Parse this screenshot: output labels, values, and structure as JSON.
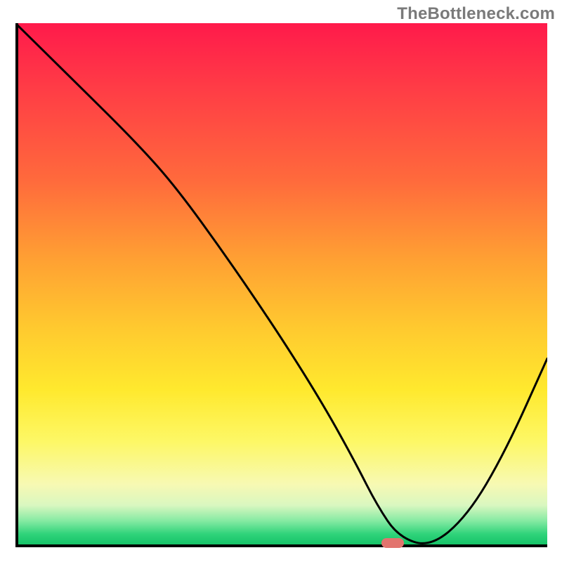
{
  "watermark": "TheBottleneck.com",
  "chart_data": {
    "type": "line",
    "title": "",
    "xlabel": "",
    "ylabel": "",
    "xlim": [
      0,
      100
    ],
    "ylim": [
      0,
      100
    ],
    "x": [
      0,
      10,
      22,
      30,
      40,
      50,
      58,
      64,
      68,
      72,
      78,
      85,
      92,
      100
    ],
    "values": [
      100,
      90,
      78,
      69,
      55,
      40,
      27,
      16,
      8,
      2,
      0,
      6,
      18,
      36
    ],
    "marker": {
      "x": 71,
      "y": 0.5
    },
    "background_gradient": {
      "top": "#ff1a4b",
      "mid": "#ffe92e",
      "bottom": "#0fbf63"
    }
  }
}
